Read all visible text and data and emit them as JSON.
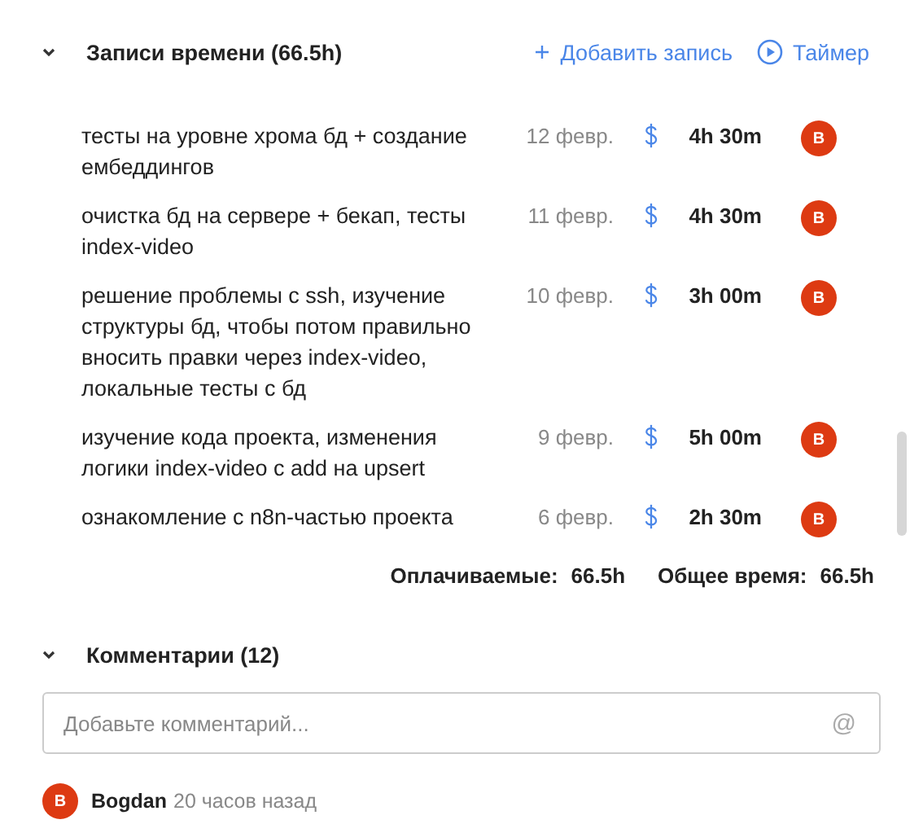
{
  "time_entries": {
    "title": "Записи времени (66.5h)",
    "expanded": true,
    "add_button": "Добавить запись",
    "timer_button": "Таймер",
    "entries": [
      {
        "description": "тесты на уровне хрома бд + создание ембеддингов",
        "date": "12 февр.",
        "billable": true,
        "duration": "4h 30m",
        "avatar": "B"
      },
      {
        "description": "очистка бд на сервере + бекап, тесты index-video",
        "date": "11 февр.",
        "billable": true,
        "duration": "4h 30m",
        "avatar": "B"
      },
      {
        "description": "решение проблемы с ssh, изучение структуры бд, чтобы потом правильно вносить правки через index-video, локальные тесты с бд",
        "date": "10 февр.",
        "billable": true,
        "duration": "3h 00m",
        "avatar": "B"
      },
      {
        "description": "изучение кода проекта, изменения логики index-video с add на upsert",
        "date": "9 февр.",
        "billable": true,
        "duration": "5h 00m",
        "avatar": "B"
      },
      {
        "description": "ознакомление с n8n-частью проекта",
        "date": "6 февр.",
        "billable": true,
        "duration": "2h 30m",
        "avatar": "B"
      }
    ],
    "totals": [
      {
        "label": "Оплачиваемые:",
        "value": "66.5h"
      },
      {
        "label": "Общее время:",
        "value": "66.5h"
      }
    ]
  },
  "comments": {
    "title": "Комментарии (12)",
    "expanded": true,
    "input": {
      "placeholder": "Добавьте комментарий...",
      "mention_button": "@"
    },
    "items": [
      {
        "avatar": "B",
        "author": "Bogdan",
        "time": "20 часов назад"
      }
    ]
  }
}
